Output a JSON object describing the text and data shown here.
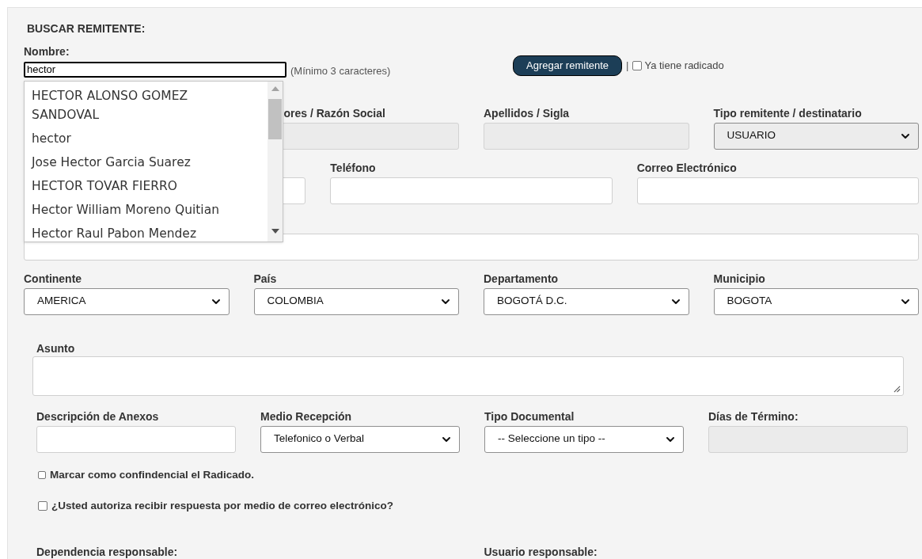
{
  "section_title": "BUSCAR REMITENTE:",
  "search": {
    "label": "Nombre:",
    "value": "hector",
    "hint": "(Mínimo 3 caracteres)",
    "suggestions": [
      {
        "text": "HECTOR ALONSO GOMEZ SANDOVAL"
      },
      {
        "text": "hector"
      },
      {
        "text": "Jose Hector Garcia Suarez"
      },
      {
        "text": "HECTOR TOVAR FIERRO"
      },
      {
        "text": "Hector William Moreno Quitian"
      },
      {
        "text": "Hector Raul Pabon Mendez"
      }
    ]
  },
  "add_button": "Agregar remitente",
  "separator": "|",
  "already_filed": {
    "label": "Ya tiene radicado",
    "checked": false
  },
  "identity_row": [
    {
      "kind": "disabled",
      "label": "ores / Razón Social"
    },
    {
      "kind": "disabled",
      "label": "Apellidos / Sigla"
    },
    {
      "kind": "select",
      "label": "Tipo remitente / destinatario",
      "value": "USUARIO"
    }
  ],
  "contact_row": [
    {
      "kind": "input"
    },
    {
      "kind": "input",
      "label": "Teléfono"
    },
    {
      "kind": "input",
      "label": "Correo Electrónico"
    }
  ],
  "address_row": [
    {
      "kind": "input"
    }
  ],
  "location_row": [
    {
      "kind": "select",
      "label": "Continente",
      "value": "AMERICA"
    },
    {
      "kind": "select",
      "label": "País",
      "value": "COLOMBIA"
    },
    {
      "kind": "select",
      "label": "Departamento",
      "value": "BOGOTÁ D.C."
    },
    {
      "kind": "select",
      "label": "Municipio",
      "value": "BOGOTA"
    }
  ],
  "subject": {
    "label": "Asunto"
  },
  "details_row": [
    {
      "kind": "input",
      "label": "Descripción de Anexos"
    },
    {
      "kind": "select",
      "label": "Medio Recepción",
      "value": "Telefonico o Verbal"
    },
    {
      "kind": "select",
      "label": "Tipo Documental",
      "value": "-- Seleccione un tipo --"
    },
    {
      "kind": "disabled",
      "label": "Días de Término:"
    }
  ],
  "options": [
    {
      "label": "Marcar como confindencial el Radicado.",
      "checked": false
    },
    {
      "label": "¿Usted autoriza recibir respuesta por medio de correo electrónico?",
      "checked": false
    }
  ],
  "responsible": [
    {
      "label": "Dependencia responsable:"
    },
    {
      "label": "Usuario responsable:"
    }
  ]
}
